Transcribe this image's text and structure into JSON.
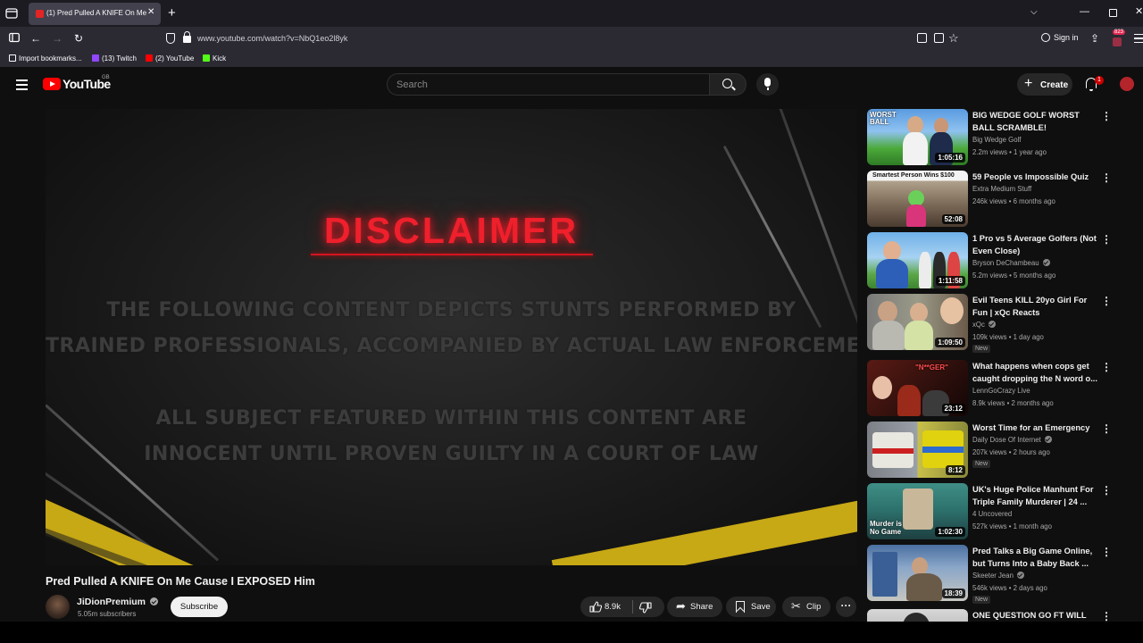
{
  "browser": {
    "tab_title": "(1) Pred Pulled A KNIFE On Me",
    "url": "www.youtube.com/watch?v=NbQ1eo2l8yk",
    "sign_in_label": "Sign in",
    "ext_badge": "823",
    "bookmarks": [
      {
        "label": "Import bookmarks...",
        "icon_color": "#fbfbfe"
      },
      {
        "label": "(13) Twitch",
        "icon_color": "#9146ff"
      },
      {
        "label": "(2) YouTube",
        "icon_color": "#ff0000"
      },
      {
        "label": "Kick",
        "icon_color": "#53fc18"
      }
    ]
  },
  "masthead": {
    "logo_text": "YouTube",
    "country_code": "GB",
    "search_placeholder": "Search",
    "create_label": "Create",
    "notification_count": "1"
  },
  "player": {
    "heading": "DISCLAIMER",
    "lines": [
      "THE FOLLOWING CONTENT DEPICTS STUNTS PERFORMED BY",
      "TRAINED PROFESSIONALS, ACCOMPANIED BY ACTUAL LAW ENFORCEMENT",
      "",
      "ALL SUBJECT FEATURED WITHIN THIS CONTENT ARE",
      "INNOCENT UNTIL PROVEN GUILTY IN A COURT OF LAW"
    ]
  },
  "video": {
    "title": "Pred Pulled A KNIFE On Me Cause I EXPOSED Him",
    "channel": "JiDionPremium",
    "subscribers": "5.05m subscribers",
    "subscribe_label": "Subscribe",
    "likes": "8.9k",
    "share_label": "Share",
    "save_label": "Save",
    "clip_label": "Clip"
  },
  "recommendations": [
    {
      "title": "BIG WEDGE GOLF WORST BALL SCRAMBLE!",
      "channel": "Big Wedge Golf",
      "verified": false,
      "meta": "2.2m views • 1 year ago",
      "duration": "1:05:16",
      "is_new": false,
      "thumb_label": "WORST BALL"
    },
    {
      "title": "59 People vs Impossible Quiz",
      "channel": "Extra Medium Stuff",
      "verified": false,
      "meta": "246k views • 6 months ago",
      "duration": "52:08",
      "is_new": false,
      "thumb_label": "Smartest Person Wins $100"
    },
    {
      "title": "1 Pro vs 5 Average Golfers (Not Even Close)",
      "channel": "Bryson DeChambeau",
      "verified": true,
      "meta": "5.2m views • 5 months ago",
      "duration": "1:11:58",
      "is_new": false,
      "thumb_label": ""
    },
    {
      "title": "Evil Teens KILL 20yo Girl For Fun | xQc Reacts",
      "channel": "xQc",
      "verified": true,
      "meta": "109k views • 1 day ago",
      "duration": "1:09:50",
      "is_new": true,
      "thumb_label": ""
    },
    {
      "title": "What happens when cops get caught dropping the N word o...",
      "channel": "LennGoCrazy Live",
      "verified": false,
      "meta": "8.9k views • 2 months ago",
      "duration": "23:12",
      "is_new": false,
      "thumb_label": "\"N**GER\""
    },
    {
      "title": "Worst Time for an Emergency",
      "channel": "Daily Dose Of Internet",
      "verified": true,
      "meta": "207k views • 2 hours ago",
      "duration": "8:12",
      "is_new": true,
      "thumb_label": ""
    },
    {
      "title": "UK's Huge Police Manhunt For Triple Family Murderer | 24 ...",
      "channel": "4 Uncovered",
      "verified": false,
      "meta": "527k views • 1 month ago",
      "duration": "1:02:30",
      "is_new": false,
      "thumb_label": "Murder is No Game"
    },
    {
      "title": "Pred Talks a Big Game Online, but Turns Into a Baby Back ...",
      "channel": "Skeeter Jean",
      "verified": true,
      "meta": "546k views • 2 days ago",
      "duration": "18:39",
      "is_new": true,
      "thumb_label": ""
    },
    {
      "title": "ONE QUESTION GO FT WILL",
      "channel": "",
      "verified": false,
      "meta": "",
      "duration": "",
      "is_new": false,
      "thumb_label": ""
    }
  ],
  "labels": {
    "new_badge": "New"
  }
}
